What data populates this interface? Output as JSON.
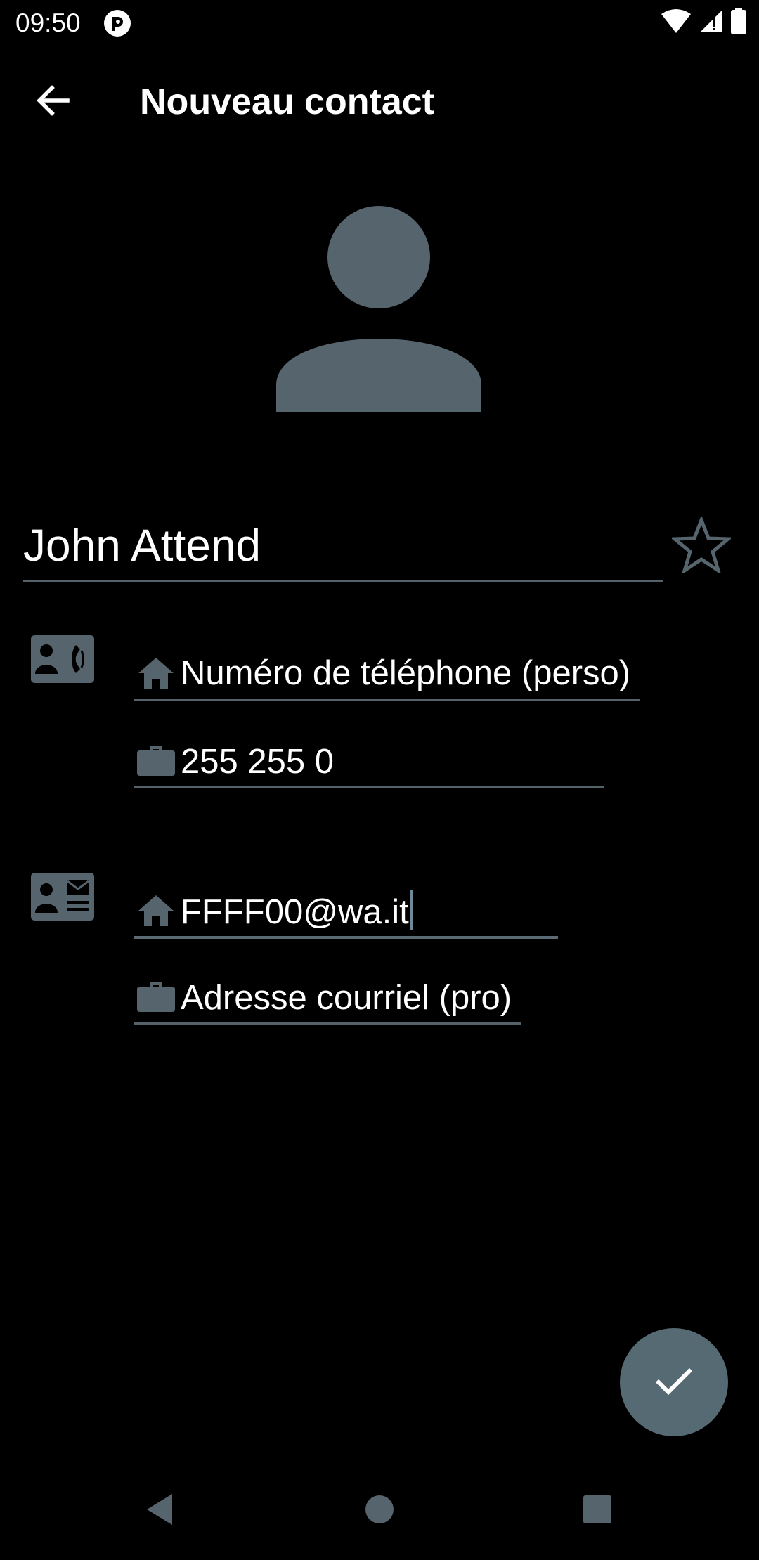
{
  "status_bar": {
    "time": "09:50",
    "app_icon": "circle-app-icon",
    "icons": [
      "wifi-icon",
      "cell-signal-icon",
      "battery-icon"
    ]
  },
  "toolbar": {
    "back_icon": "arrow-back-icon",
    "title": "Nouveau contact"
  },
  "avatar": {
    "icon": "person-placeholder-icon"
  },
  "name": {
    "value": "John Attend",
    "favorite_icon": "star-outline-icon"
  },
  "phone_section": {
    "section_icon": "contact-phone-icon",
    "fields": [
      {
        "type_icon": "home-icon",
        "value": "Numéro de téléphone (perso)"
      },
      {
        "type_icon": "briefcase-icon",
        "value": "255 255 0"
      }
    ]
  },
  "email_section": {
    "section_icon": "contact-mail-icon",
    "fields": [
      {
        "type_icon": "home-icon",
        "value": "FFFF00@wa.it"
      },
      {
        "type_icon": "briefcase-icon",
        "value": "Adresse courriel (pro)"
      }
    ]
  },
  "fab": {
    "icon": "check-icon"
  },
  "nav_bar": {
    "icons": [
      "nav-back-icon",
      "nav-home-icon",
      "nav-recents-icon"
    ]
  },
  "colors": {
    "background": "#000000",
    "accent": "#566a73",
    "icon_gray": "#56656d",
    "text": "#ffffff",
    "underline": "#56626a"
  }
}
